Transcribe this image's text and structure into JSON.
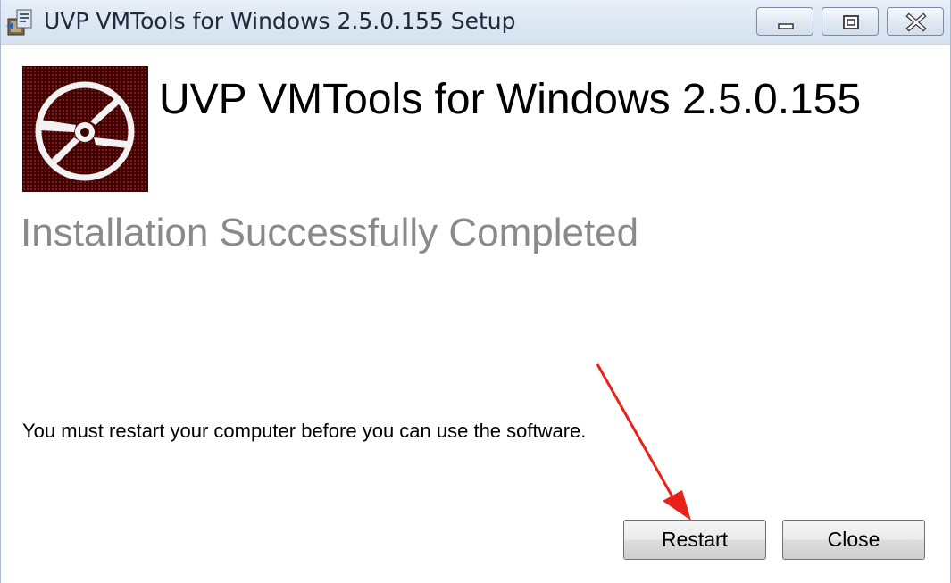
{
  "window": {
    "title": "UVP VMTools for Windows 2.5.0.155 Setup",
    "icon": "installer-icon",
    "controls": {
      "minimize_icon": "minimize-icon",
      "maximize_icon": "maximize-icon",
      "close_icon": "close-icon"
    }
  },
  "dialog": {
    "logo_icon": "disc-logo-icon",
    "product_title": "UVP VMTools for Windows 2.5.0.155",
    "status_heading": "Installation Successfully Completed",
    "message": "You must restart your computer before you can use the software.",
    "buttons": {
      "restart_label": "Restart",
      "close_label": "Close"
    }
  },
  "colors": {
    "logo_background": "#5a0a0a",
    "heading_gray": "#8a8a8a",
    "annotation_arrow": "#e8221b"
  }
}
